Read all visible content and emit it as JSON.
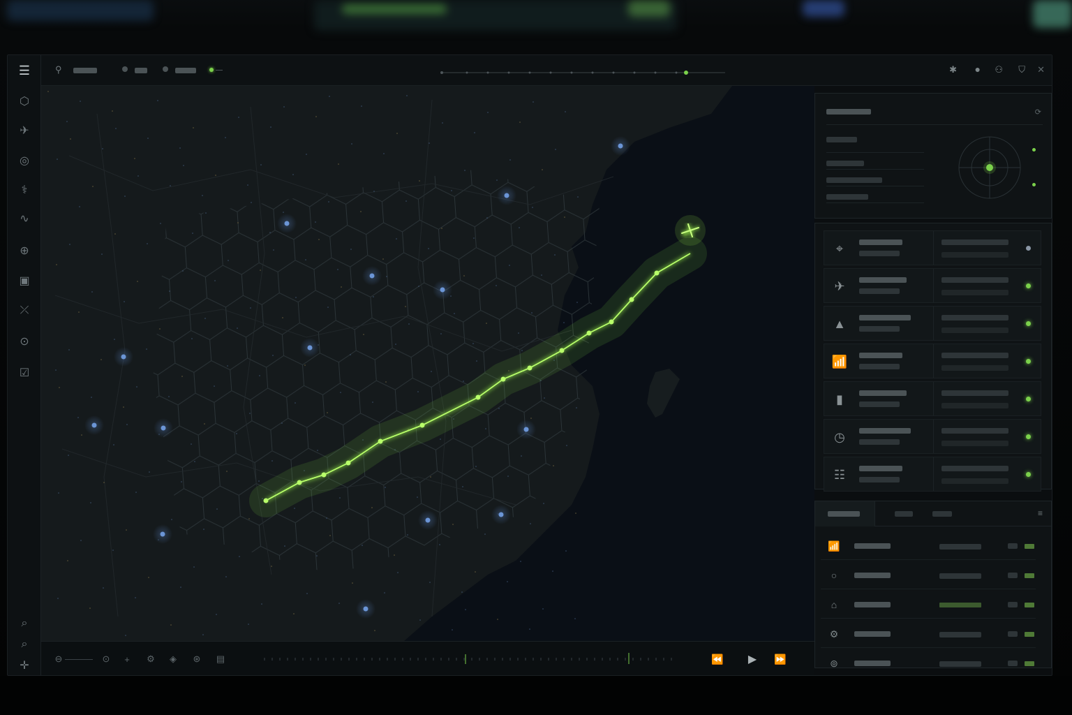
{
  "app": {
    "window": "flight tracking console",
    "menu_icon": "menu-icon"
  },
  "sidebar": {
    "items": [
      {
        "icon": "hexagon-icon"
      },
      {
        "icon": "aircraft-icon"
      },
      {
        "icon": "target-icon"
      },
      {
        "icon": "signal-icon"
      },
      {
        "icon": "waveform-icon"
      },
      {
        "icon": "crosshair-icon"
      },
      {
        "icon": "chart-icon"
      },
      {
        "icon": "plane-off-icon"
      },
      {
        "icon": "radar-icon"
      },
      {
        "icon": "checklist-icon"
      }
    ],
    "bottom": [
      {
        "icon": "zoom-in-icon"
      },
      {
        "icon": "zoom-out-icon"
      },
      {
        "icon": "compass-icon"
      }
    ]
  },
  "topbar": {
    "right_icons": [
      "settings-icon",
      "alert-icon",
      "user-icon",
      "shield-icon",
      "close-icon"
    ]
  },
  "map": {
    "route_color": "#9bf24a",
    "land_color": "#14191b",
    "sea_color": "#0b1017",
    "hex_color": "#2c3438",
    "node_color": "#5b86c9"
  },
  "status_list": {
    "items": [
      {
        "icon": "crosshair-icon",
        "status": "inactive"
      },
      {
        "icon": "aircraft-icon",
        "status": "ok"
      },
      {
        "icon": "warning-icon",
        "status": "ok"
      },
      {
        "icon": "antenna-icon",
        "status": "ok"
      },
      {
        "icon": "bar-chart-icon",
        "status": "ok"
      },
      {
        "icon": "clock-icon",
        "status": "ok"
      },
      {
        "icon": "sliders-icon",
        "status": "ok"
      }
    ]
  },
  "list_panel": {
    "items": [
      {
        "icon": "antenna-icon"
      },
      {
        "icon": "circle-icon"
      },
      {
        "icon": "home-icon"
      },
      {
        "icon": "settings-icon"
      },
      {
        "icon": "signal-icon"
      }
    ]
  },
  "playback": {
    "controls": [
      "rewind-icon",
      "play-icon",
      "fast-forward-icon"
    ]
  }
}
